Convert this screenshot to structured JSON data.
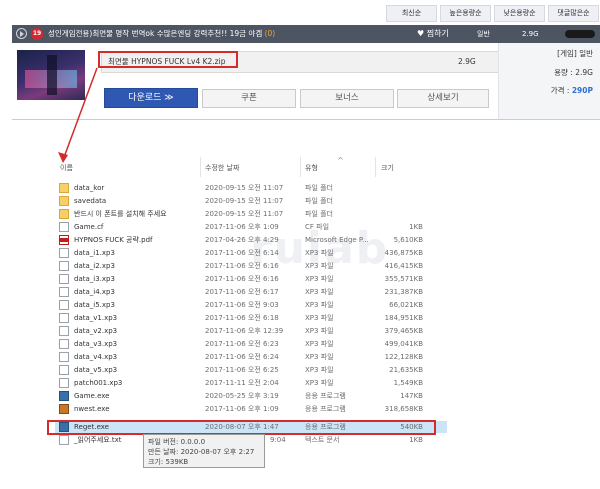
{
  "sort_bar": [
    "최신순",
    "높은용량순",
    "낮은용량순",
    "댓글많은순"
  ],
  "title_bar": {
    "age_badge": "19",
    "title": "성인게임전용)최면물 명작 번역ok 수많은엔딩 강력추천!! 19금 야겜",
    "count": "(0)",
    "favorite_label": "♥ 찜하기",
    "category": "일반",
    "size": "2.9G"
  },
  "file_panel": {
    "filename": "최면물 HYPNOS FUCK Lv4 K2.zip",
    "filesize": "2.9G",
    "buttons": {
      "download": "다운로드 ≫",
      "coupon": "쿠폰",
      "bonus": "보너스",
      "details": "상세보기"
    },
    "info": {
      "category": "[게임] 일반",
      "size_label": "용량 : 2.9G",
      "price_label": "가격 : ",
      "price": "290P"
    }
  },
  "explorer": {
    "headers": {
      "name": "이름",
      "date": "수정한 날짜",
      "type": "유형",
      "size": "크기"
    },
    "rows": [
      {
        "icon": "folder",
        "name": "data_kor",
        "date": "2020-09-15 오전 11:07",
        "type": "파일 폴더",
        "size": ""
      },
      {
        "icon": "folder",
        "name": "savedata",
        "date": "2020-09-15 오전 11:07",
        "type": "파일 폴더",
        "size": ""
      },
      {
        "icon": "folder",
        "name": "반드시 이 폰트를 설치해 주세요",
        "date": "2020-09-15 오전 11:07",
        "type": "파일 폴더",
        "size": ""
      },
      {
        "icon": "cf",
        "name": "Game.cf",
        "date": "2017-11-06 오후 1:09",
        "type": "CF 파일",
        "size": "1KB"
      },
      {
        "icon": "pdf",
        "name": "HYPNOS FUCK 공략.pdf",
        "date": "2017-04-26 오후 4:29",
        "type": "Microsoft Edge P...",
        "size": "5,610KB"
      },
      {
        "icon": "file",
        "name": "data_i1.xp3",
        "date": "2017-11-06 오전 6:14",
        "type": "XP3 파일",
        "size": "436,875KB"
      },
      {
        "icon": "file",
        "name": "data_i2.xp3",
        "date": "2017-11-06 오전 6:16",
        "type": "XP3 파일",
        "size": "416,415KB"
      },
      {
        "icon": "file",
        "name": "data_i3.xp3",
        "date": "2017-11-06 오전 6:16",
        "type": "XP3 파일",
        "size": "355,571KB"
      },
      {
        "icon": "file",
        "name": "data_i4.xp3",
        "date": "2017-11-06 오전 6:17",
        "type": "XP3 파일",
        "size": "231,387KB"
      },
      {
        "icon": "file",
        "name": "data_i5.xp3",
        "date": "2017-11-06 오전 9:03",
        "type": "XP3 파일",
        "size": "66,021KB"
      },
      {
        "icon": "file",
        "name": "data_v1.xp3",
        "date": "2017-11-06 오전 6:18",
        "type": "XP3 파일",
        "size": "184,951KB"
      },
      {
        "icon": "file",
        "name": "data_v2.xp3",
        "date": "2017-11-06 오후 12:39",
        "type": "XP3 파일",
        "size": "379,465KB"
      },
      {
        "icon": "file",
        "name": "data_v3.xp3",
        "date": "2017-11-06 오전 6:23",
        "type": "XP3 파일",
        "size": "499,041KB"
      },
      {
        "icon": "file",
        "name": "data_v4.xp3",
        "date": "2017-11-06 오전 6:24",
        "type": "XP3 파일",
        "size": "122,128KB"
      },
      {
        "icon": "file",
        "name": "data_v5.xp3",
        "date": "2017-11-06 오전 6:25",
        "type": "XP3 파일",
        "size": "21,635KB"
      },
      {
        "icon": "file",
        "name": "patch001.xp3",
        "date": "2017-11-11 오전 2:04",
        "type": "XP3 파일",
        "size": "1,549KB"
      },
      {
        "icon": "exe",
        "name": "Game.exe",
        "date": "2020-05-25 오후 3:19",
        "type": "응용 프로그램",
        "size": "147KB"
      },
      {
        "icon": "exe2",
        "name": "nwest.exe",
        "date": "2017-11-06 오후 1:09",
        "type": "응용 프로그램",
        "size": "318,658KB"
      },
      {
        "icon": "exe",
        "name": "Reget.exe",
        "date": "2020-08-07 오후 1:47",
        "type": "응용 프로그램",
        "size": "540KB"
      },
      {
        "icon": "txt",
        "name": "_읽어주세요.txt",
        "date": "9:04",
        "type": "텍스트 문서",
        "size": "1KB"
      }
    ],
    "tooltip": [
      "파일 버전: 0.0.0.0",
      "만든 날짜: 2020-08-07 오후 2:27",
      "크기: 539KB"
    ]
  },
  "watermark": "ruiab",
  "colors": {
    "highlight": "#d42b2b",
    "download": "#2e58b2",
    "titlebar": "#4d5563",
    "price": "#2e6fd0"
  }
}
